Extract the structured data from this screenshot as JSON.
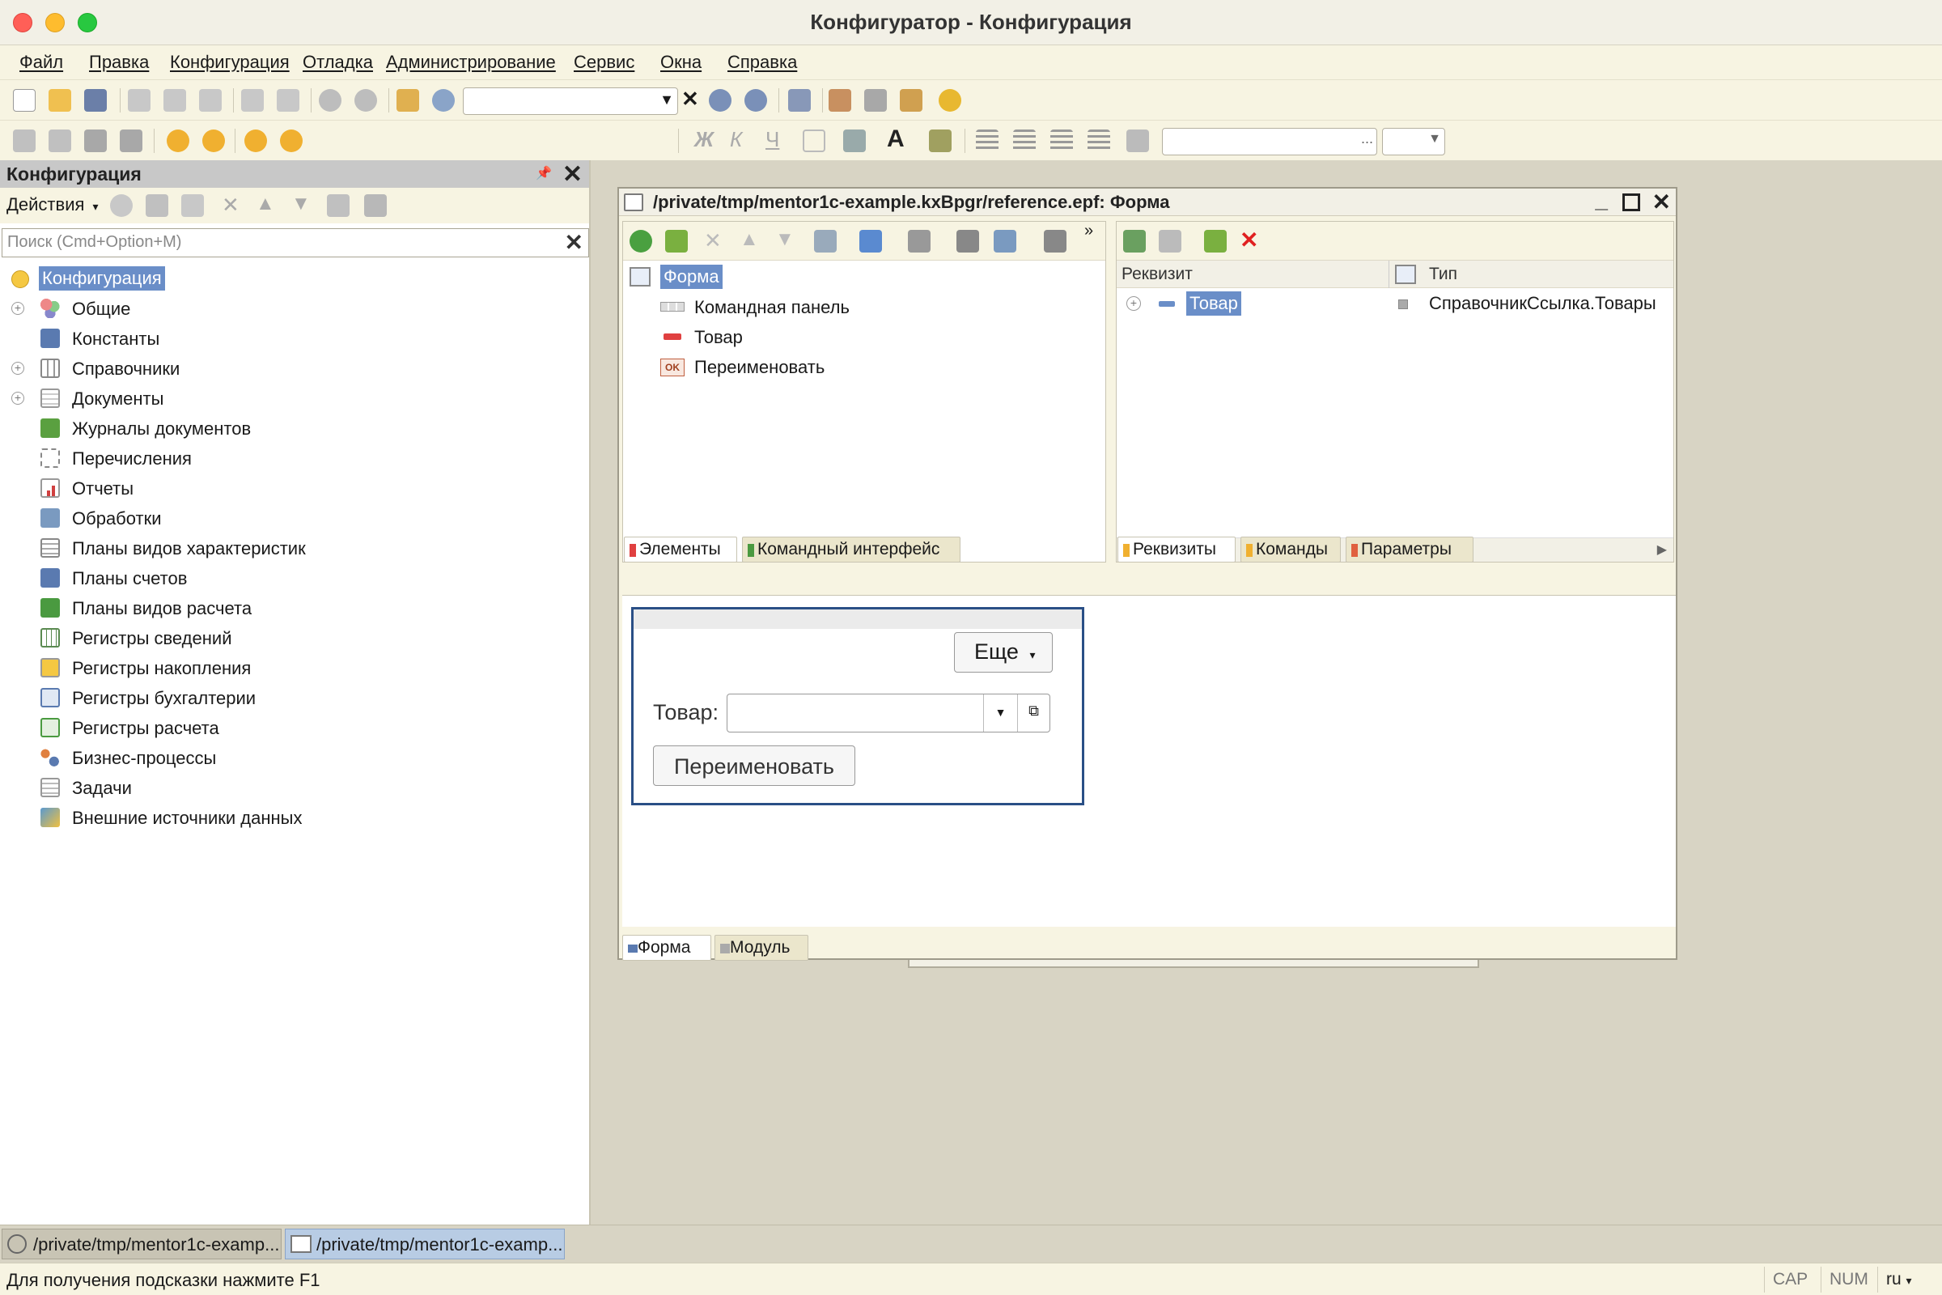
{
  "window": {
    "title": "Конфигуратор - Конфигурация"
  },
  "menu": [
    "Файл",
    "Правка",
    "Конфигурация",
    "Отладка",
    "Администрирование",
    "Сервис",
    "Окна",
    "Справка"
  ],
  "left_panel": {
    "title": "Конфигурация",
    "actions_label": "Действия",
    "search_placeholder": "Поиск (Cmd+Option+M)",
    "root": "Конфигурация",
    "items": [
      {
        "label": "Общие",
        "expandable": true,
        "icon": "common-icon"
      },
      {
        "label": "Константы",
        "expandable": false,
        "icon": "constants-icon"
      },
      {
        "label": "Справочники",
        "expandable": true,
        "icon": "catalogs-icon"
      },
      {
        "label": "Документы",
        "expandable": true,
        "icon": "documents-icon"
      },
      {
        "label": "Журналы документов",
        "expandable": false,
        "icon": "journals-icon"
      },
      {
        "label": "Перечисления",
        "expandable": false,
        "icon": "enums-icon"
      },
      {
        "label": "Отчеты",
        "expandable": false,
        "icon": "reports-icon"
      },
      {
        "label": "Обработки",
        "expandable": false,
        "icon": "dataprocessors-icon"
      },
      {
        "label": "Планы видов характеристик",
        "expandable": false,
        "icon": "chart-of-char-icon"
      },
      {
        "label": "Планы счетов",
        "expandable": false,
        "icon": "chart-of-accounts-icon"
      },
      {
        "label": "Планы видов расчета",
        "expandable": false,
        "icon": "chart-of-calc-icon"
      },
      {
        "label": "Регистры сведений",
        "expandable": false,
        "icon": "info-registers-icon"
      },
      {
        "label": "Регистры накопления",
        "expandable": false,
        "icon": "accum-registers-icon"
      },
      {
        "label": "Регистры бухгалтерии",
        "expandable": false,
        "icon": "acc-registers-icon"
      },
      {
        "label": "Регистры расчета",
        "expandable": false,
        "icon": "calc-registers-icon"
      },
      {
        "label": "Бизнес-процессы",
        "expandable": false,
        "icon": "business-process-icon"
      },
      {
        "label": "Задачи",
        "expandable": false,
        "icon": "tasks-icon"
      },
      {
        "label": "Внешние источники данных",
        "expandable": false,
        "icon": "external-sources-icon"
      }
    ]
  },
  "form_window": {
    "title": "/private/tmp/mentor1c-example.kxBpgr/reference.epf: Форма",
    "elements": {
      "root": "Форма",
      "items": [
        "Командная панель",
        "Товар",
        "Переименовать"
      ]
    },
    "left_tabs": [
      "Элементы",
      "Командный интерфейс"
    ],
    "attributes": {
      "col_attr": "Реквизит",
      "col_type": "Тип",
      "rows": [
        {
          "name": "Товар",
          "type": "СправочникСсылка.Товары"
        }
      ]
    },
    "right_tabs": [
      "Реквизиты",
      "Команды",
      "Параметры"
    ],
    "preview": {
      "more_button": "Еще",
      "field_label": "Товар:",
      "field_value": "",
      "rename_button": "Переименовать"
    },
    "bottom_tabs": [
      "Форма",
      "Модуль"
    ]
  },
  "open_windows": [
    "/private/tmp/mentor1c-examp...",
    "/private/tmp/mentor1c-examp..."
  ],
  "status": {
    "hint": "Для получения подсказки нажмите F1",
    "cap": "CAP",
    "num": "NUM",
    "lang": "ru"
  }
}
